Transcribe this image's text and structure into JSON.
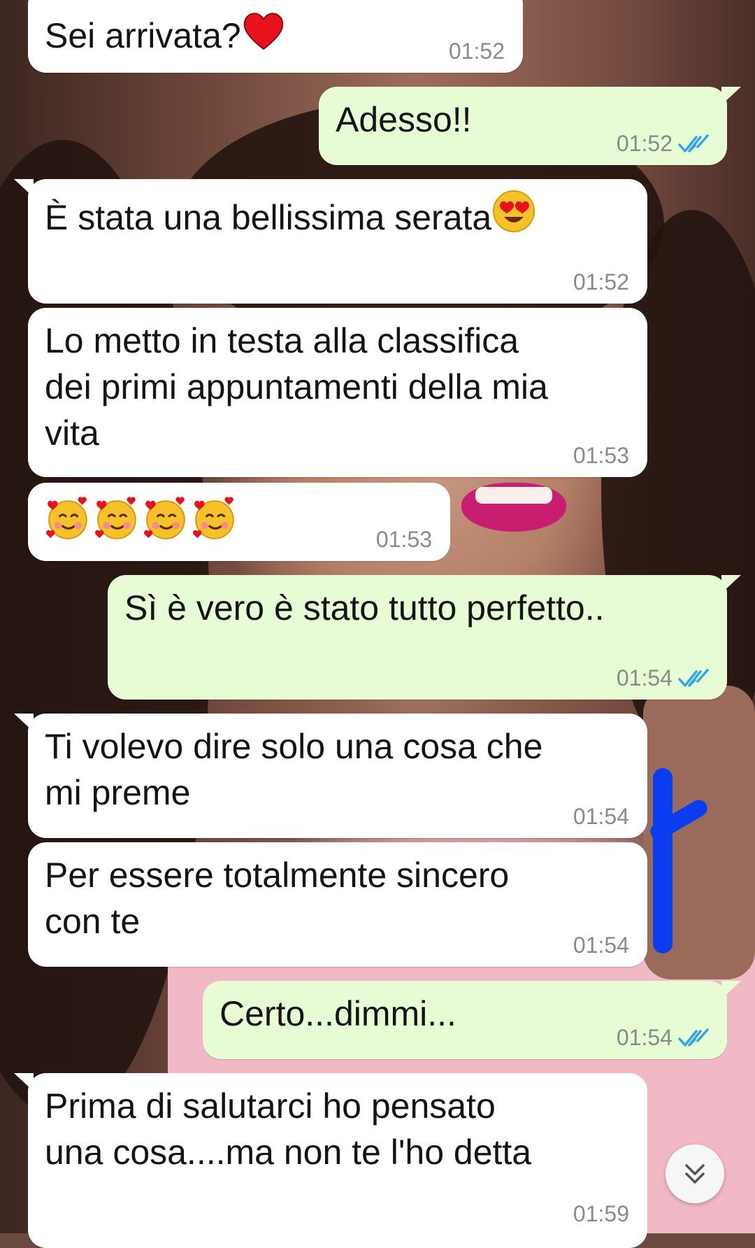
{
  "messages": [
    {
      "dir": "in",
      "text": "Sei arrivata?",
      "emoji": "red-heart",
      "time": "01:52"
    },
    {
      "dir": "out",
      "text": "Adesso!!",
      "time": "01:52",
      "read": true
    },
    {
      "dir": "in",
      "text": "È stata una bellissima serata",
      "emoji": "heart-eyes",
      "time": "01:52"
    },
    {
      "dir": "in",
      "text": "Lo metto in testa alla classifica\ndei primi appuntamenti della mia\nvita",
      "time": "01:53"
    },
    {
      "dir": "in",
      "text": "",
      "emoji": "smiling-face-with-hearts-x4",
      "time": "01:53"
    },
    {
      "dir": "out",
      "text": "Sì è vero è stato tutto perfetto..",
      "time": "01:54",
      "read": true
    },
    {
      "dir": "in",
      "text": "Ti volevo dire solo una cosa che\nmi preme",
      "time": "01:54"
    },
    {
      "dir": "in",
      "text": "Per essere totalmente sincero\ncon te",
      "time": "01:54"
    },
    {
      "dir": "out",
      "text": "Certo...dimmi...",
      "time": "01:54",
      "read": true
    },
    {
      "dir": "in",
      "text": "Prima di salutarci ho pensato\nuna cosa....ma non te l'ho detta",
      "time": "01:59"
    }
  ],
  "colors": {
    "incoming": "#ffffff",
    "outgoing": "#e7fcd4",
    "read_ticks": "#34a6e6",
    "timestamp": "#8a8a8a",
    "annotation": "#0a3df0"
  },
  "scroll_button": {
    "icon": "double-chevron-down-icon"
  }
}
